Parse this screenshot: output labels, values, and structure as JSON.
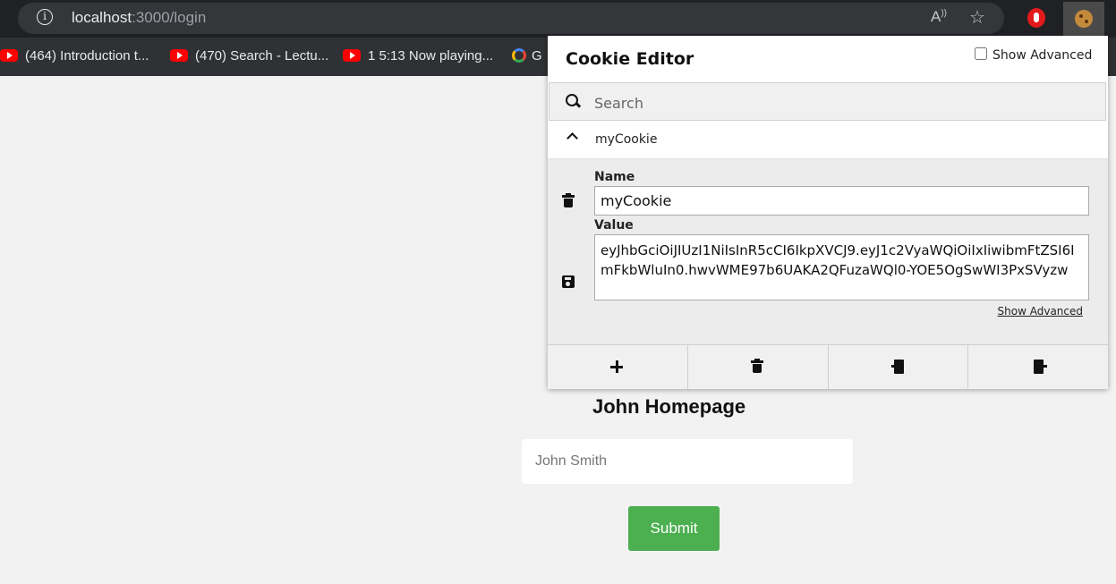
{
  "browser": {
    "url_host": "localhost",
    "url_path": ":3000/login",
    "bookmarks": [
      {
        "label": "(464) Introduction t...",
        "icon": "youtube-icon"
      },
      {
        "label": "(470) Search - Lectu...",
        "icon": "youtube-icon"
      },
      {
        "label": "1 5:13 Now playing...",
        "icon": "youtube-icon"
      },
      {
        "label": "G",
        "icon": "google-cloud-icon"
      }
    ]
  },
  "page": {
    "title": "John Homepage",
    "name_placeholder": "John Smith",
    "submit_label": "Submit",
    "accent": "#4caf50"
  },
  "cookie_editor": {
    "title": "Cookie Editor",
    "show_advanced_label": "Show Advanced",
    "search_placeholder": "Search",
    "cookie_name": "myCookie",
    "name_label": "Name",
    "name_value": "myCookie",
    "value_label": "Value",
    "value_text": "eyJhbGciOiJIUzI1NiIsInR5cCI6IkpXVCJ9.eyJ1c2VyaWQiOiIxIiwibmFtZSI6ImFkbWluIn0.hwvWME97b6UAKA2QFuzaWQl0-YOE5OgSwWI3PxSVyzw",
    "show_advanced_link": "Show Advanced",
    "toolbar": [
      "add-cookie",
      "delete-all",
      "import",
      "export"
    ]
  }
}
